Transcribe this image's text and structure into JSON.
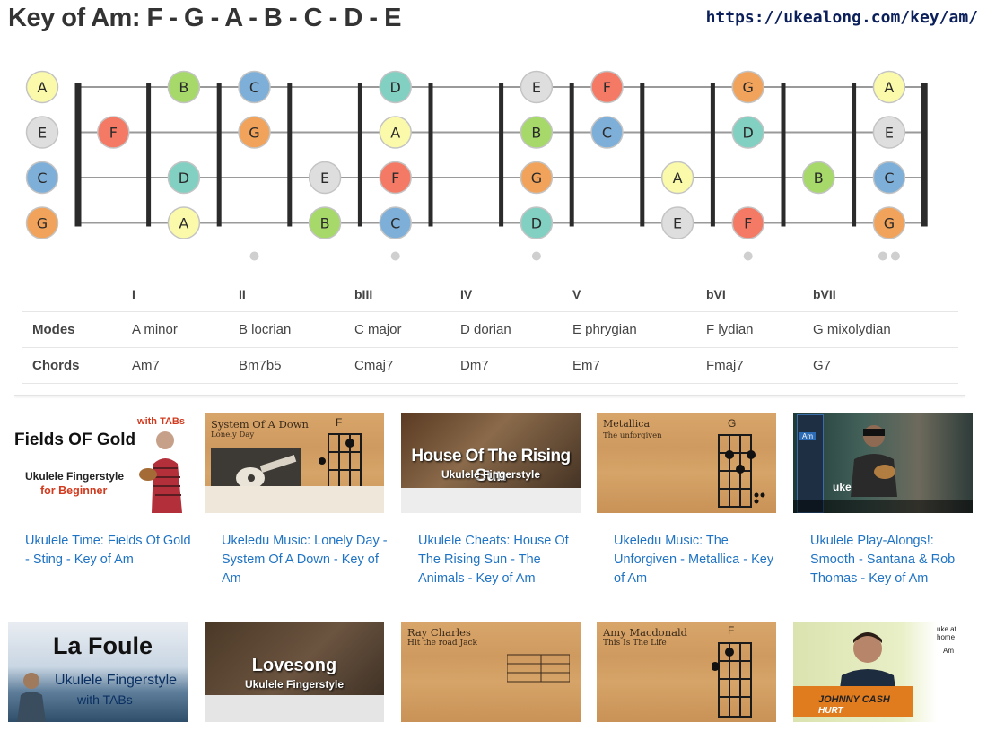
{
  "header": {
    "title": "Key of Am: F - G - A - B - C - D - E",
    "url": "https://ukealong.com/key/am/"
  },
  "colors": {
    "A": "#fafaaa",
    "B": "#a6d96a",
    "C": "#7eafd9",
    "D": "#82d0c2",
    "E": "#dedede",
    "F": "#f47a66",
    "G": "#f2a35b"
  },
  "fretboard": {
    "open_notes": [
      "A",
      "E",
      "C",
      "G"
    ],
    "notes_by_string": [
      {
        "1": "",
        "2": "B",
        "3": "C",
        "4": "",
        "5": "D",
        "6": "",
        "7": "E",
        "8": "F",
        "9": "",
        "10": "G",
        "11": "",
        "12": "A"
      },
      {
        "1": "F",
        "2": "",
        "3": "G",
        "4": "",
        "5": "A",
        "6": "",
        "7": "B",
        "8": "C",
        "9": "",
        "10": "D",
        "11": "",
        "12": "E"
      },
      {
        "1": "",
        "2": "D",
        "3": "",
        "4": "E",
        "5": "F",
        "6": "",
        "7": "G",
        "8": "",
        "9": "A",
        "10": "",
        "11": "B",
        "12": "C"
      },
      {
        "1": "",
        "2": "A",
        "3": "",
        "4": "B",
        "5": "C",
        "6": "",
        "7": "D",
        "8": "",
        "9": "E",
        "10": "F",
        "11": "",
        "12": "G"
      }
    ],
    "inlay_frets": [
      3,
      5,
      7,
      10,
      12
    ]
  },
  "scale_table": {
    "degrees": [
      "I",
      "II",
      "bIII",
      "IV",
      "V",
      "bVI",
      "bVII"
    ],
    "modes_label": "Modes",
    "modes": [
      "A minor",
      "B locrian",
      "C major",
      "D dorian",
      "E phrygian",
      "F lydian",
      "G mixolydian"
    ],
    "chords_label": "Chords",
    "chords": [
      "Am7",
      "Bm7b5",
      "Cmaj7",
      "Dm7",
      "Em7",
      "Fmaj7",
      "G7"
    ]
  },
  "videos": [
    {
      "title": "Ukulele Time: Fields Of Gold - Sting - Key of Am",
      "thumb": {
        "line1": "Fields OF Gold",
        "line2": "Ukulele Fingerstyle",
        "line3": "for Beginner",
        "badge": "with TABs"
      }
    },
    {
      "title": "Ukeledu Music: Lonely Day - System Of A Down - Key of Am",
      "thumb": {
        "line1": "System Of A Down",
        "line2": "Lonely Day",
        "chord": "F"
      }
    },
    {
      "title": "Ukulele Cheats: House Of The Rising Sun - The Animals - Key of Am",
      "thumb": {
        "line1": "House Of The Rising Sun",
        "line2": "Ukulele Fingerstyle"
      }
    },
    {
      "title": "Ukeledu Music: The Unforgiven - Metallica - Key of Am",
      "thumb": {
        "line1": "Metallica",
        "line2": "The unforgiven",
        "chord": "G"
      }
    },
    {
      "title": "Ukulele Play-Alongs!: Smooth - Santana & Rob Thomas - Key of Am",
      "thumb": {
        "line1": "ukeoke",
        "chord": "Am"
      }
    },
    {
      "title": "",
      "thumb": {
        "line1": "La Foule",
        "line2": "Ukulele Fingerstyle",
        "line3": "with TABs"
      }
    },
    {
      "title": "",
      "thumb": {
        "line1": "Lovesong",
        "line2": "Ukulele Fingerstyle"
      }
    },
    {
      "title": "",
      "thumb": {
        "line1": "Ray Charles",
        "line2": "Hit the road Jack"
      }
    },
    {
      "title": "",
      "thumb": {
        "line1": "Amy Macdonald",
        "line2": "This Is The Life",
        "chord": "F"
      }
    },
    {
      "title": "",
      "thumb": {
        "line1": "JOHNNY CASH",
        "line2": "HURT",
        "badge": "uke at home",
        "chord": "Am"
      }
    }
  ]
}
